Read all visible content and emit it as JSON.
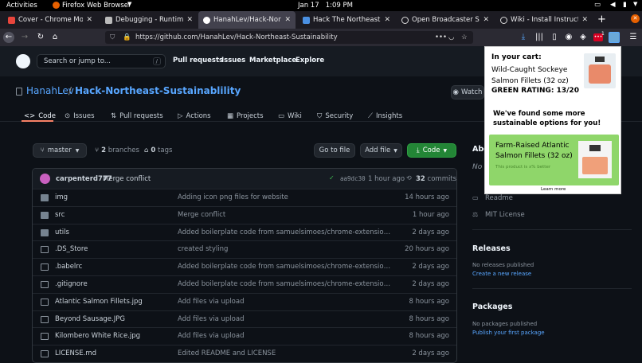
{
  "topbar": {
    "activities": "Activities",
    "app": "Firefox Web Browser",
    "clock": "Jan 17   1:09 PM"
  },
  "tabs": [
    {
      "title": "Cover - Chrome Mock",
      "color": "#e8453c"
    },
    {
      "title": "Debugging - Runtime / t",
      "color": "#bbb"
    },
    {
      "title": "HanahLev/Hack-Northea",
      "color": "#fff"
    },
    {
      "title": "Hack The Northeast: Bey",
      "color": "#4a90e2"
    },
    {
      "title": "Open Broadcaster Softw",
      "color": "#ddd"
    },
    {
      "title": "Wiki - Install Instruction",
      "color": "#ddd"
    }
  ],
  "nav": {
    "url": "https://github.com/HanahLev/Hack-Northeast-Sustainability",
    "ext_badge": "1"
  },
  "github": {
    "search_placeholder": "Search or jump to...",
    "slash": "/",
    "links": [
      "Pull requests",
      "Issues",
      "Marketplace",
      "Explore"
    ],
    "owner": "HanahLev",
    "sep": " / ",
    "repo": "Hack-Northeast-Sustainablility",
    "watch": "Watch",
    "tabs": [
      "Code",
      "Issues",
      "Pull requests",
      "Actions",
      "Projects",
      "Wiki",
      "Security",
      "Insights"
    ],
    "branch": "master",
    "branches_count": "2",
    "branches_label": "branches",
    "tags_count": "0",
    "tags_label": "tags",
    "goto_file": "Go to file",
    "add_file": "Add file",
    "code_btn": "Code",
    "commit": {
      "author": "carpenterd777",
      "message": "Merge conflict",
      "hash": "aa9dc30",
      "time": "1 hour ago",
      "count": "32",
      "count_label": "commits"
    },
    "files": [
      {
        "name": "img",
        "type": "folder",
        "msg": "Adding icon png files for website",
        "age": "14 hours ago"
      },
      {
        "name": "src",
        "type": "folder",
        "msg": "Merge conflict",
        "age": "1 hour ago"
      },
      {
        "name": "utils",
        "type": "folder",
        "msg": "Added boilerplate code from samuelsimoes/chrome-extension-webpack-...",
        "age": "2 days ago"
      },
      {
        "name": ".DS_Store",
        "type": "file",
        "msg": "created styling",
        "age": "20 hours ago"
      },
      {
        "name": ".babelrc",
        "type": "file",
        "msg": "Added boilerplate code from samuelsimoes/chrome-extension-webpack-...",
        "age": "2 days ago"
      },
      {
        "name": ".gitignore",
        "type": "file",
        "msg": "Added boilerplate code from samuelsimoes/chrome-extension-webpack-...",
        "age": "2 days ago"
      },
      {
        "name": "Atlantic Salmon Fillets.jpg",
        "type": "file",
        "msg": "Add files via upload",
        "age": "8 hours ago"
      },
      {
        "name": "Beyond Sausage.JPG",
        "type": "file",
        "msg": "Add files via upload",
        "age": "8 hours ago"
      },
      {
        "name": "Kilombero White Rice.jpg",
        "type": "file",
        "msg": "Add files via upload",
        "age": "8 hours ago"
      },
      {
        "name": "LICENSE.md",
        "type": "file",
        "msg": "Edited README and LICENSE",
        "age": "2 days ago"
      }
    ],
    "sidebar": {
      "about": "Abo",
      "about_partial": "No",
      "readme": "Readme",
      "license": "MIT License",
      "releases": "Releases",
      "no_releases": "No releases published",
      "create_release": "Create a new release",
      "packages": "Packages",
      "no_packages": "No packages published",
      "publish_package": "Publish your first package"
    }
  },
  "popup": {
    "cart_label": "In your cart:",
    "cart_item": "Wild-Caught Sockeye Salmon Fillets (32 oz)",
    "rating": "GREEN RATING: 13/20",
    "suggest": "We've found some more sustainable options for you!",
    "alt_item": "Farm-Raised Atlantic Salmon Fillets (32 oz)",
    "alt_note": "This product is x% better",
    "learn_more": "Learn more"
  }
}
